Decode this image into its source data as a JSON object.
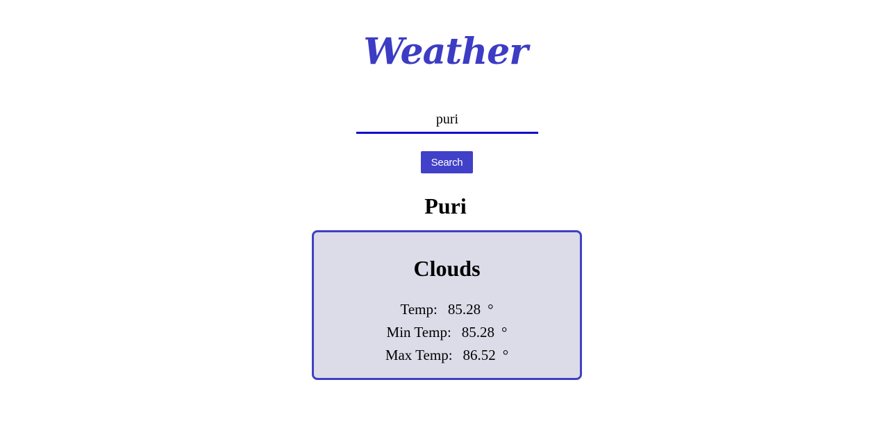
{
  "app": {
    "title": "Weather"
  },
  "search": {
    "value": "puri",
    "button_label": "Search"
  },
  "result": {
    "city": "Puri",
    "condition": "Clouds",
    "stats": {
      "temp_label": "Temp:",
      "temp_value": "85.28",
      "min_label": "Min Temp:",
      "min_value": "85.28",
      "max_label": "Max Temp:",
      "max_value": "86.52",
      "degree_symbol": "°"
    }
  },
  "colors": {
    "accent": "#4040c8",
    "input_underline": "#0c0ccc",
    "card_background": "#dcdbe8",
    "card_border": "#4040c4"
  }
}
